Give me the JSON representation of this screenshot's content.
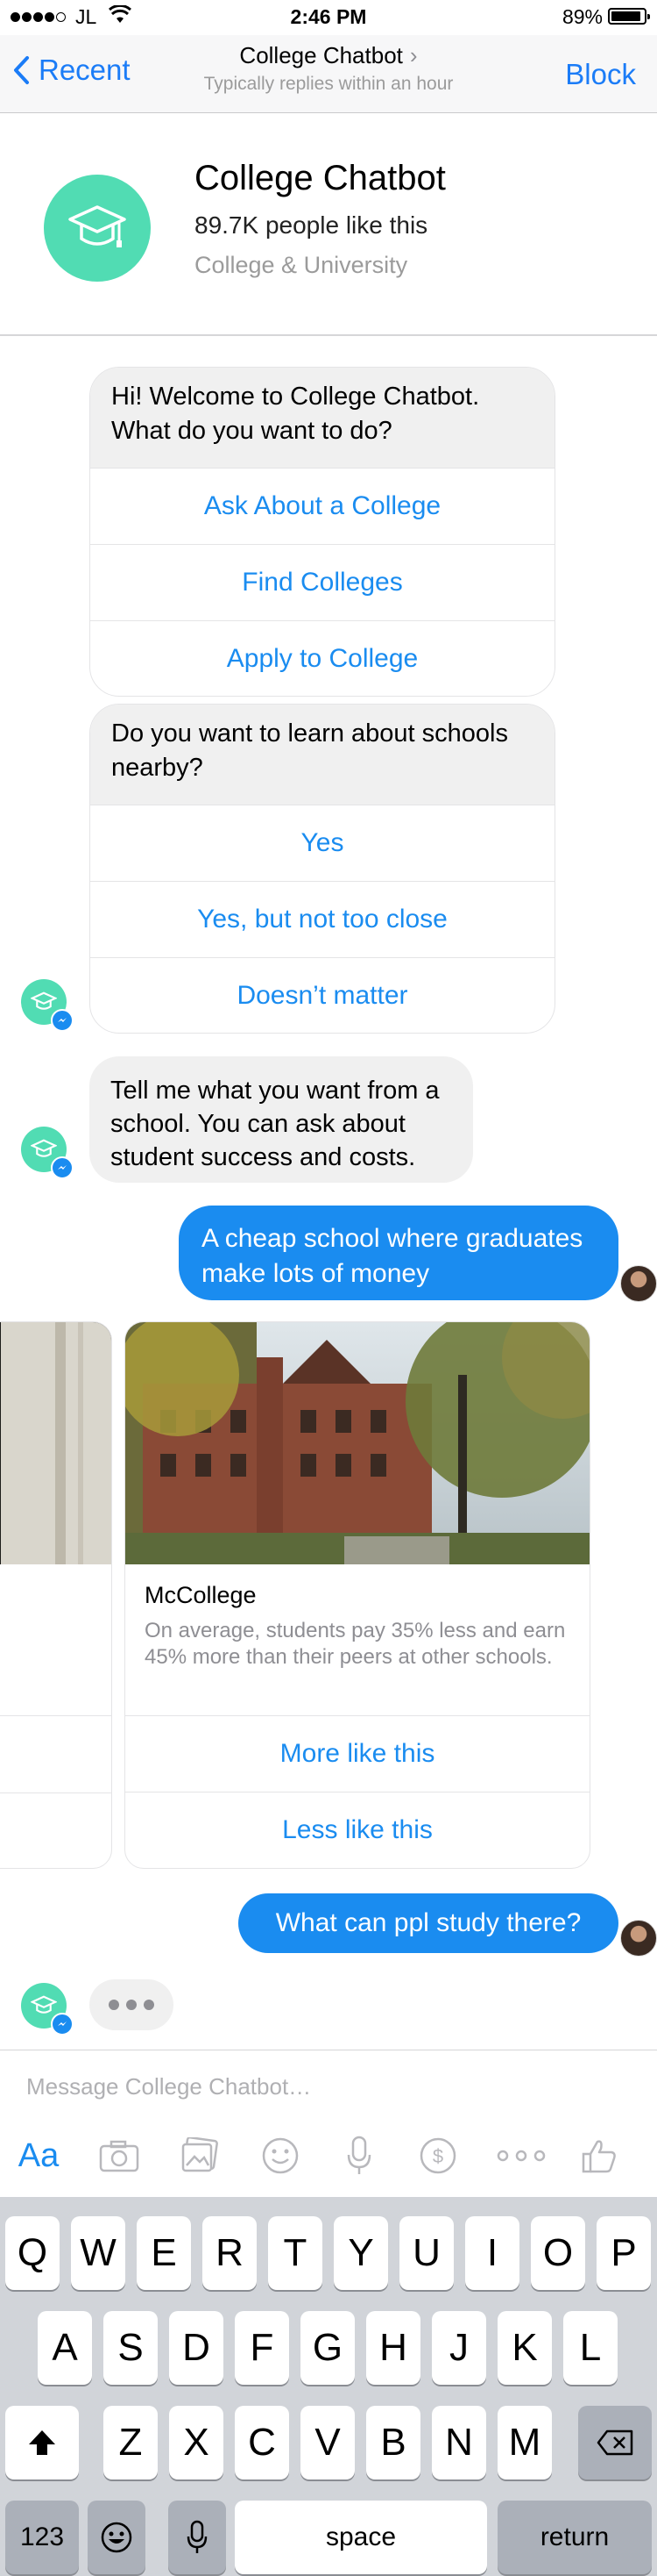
{
  "status_bar": {
    "carrier": "JL",
    "time": "2:46 PM",
    "battery": "89%",
    "battery_level": 0.89
  },
  "nav": {
    "back_label": "Recent",
    "title": "College Chatbot",
    "subtitle": "Typically replies within an hour",
    "block_label": "Block"
  },
  "page_info": {
    "name": "College Chatbot",
    "likes": "89.7K people like this",
    "category": "College & University"
  },
  "messages": {
    "welcome": {
      "text": "Hi! Welcome to College Chatbot. What do you want to do?",
      "buttons": [
        "Ask About a College",
        "Find Colleges",
        "Apply to College"
      ]
    },
    "nearby": {
      "text": "Do you want to learn about schools nearby?",
      "buttons": [
        "Yes",
        "Yes, but not too close",
        "Doesn’t matter"
      ]
    },
    "tell_me": "Tell me what you want from a school. You can ask about student success and costs.",
    "user_query_1": "A cheap school where graduates make lots of money",
    "carousel": {
      "title": "McCollege",
      "description": "On average, students pay 35% less and earn 45% more than their peers at other schools.",
      "buttons": [
        "More like this",
        "Less like this"
      ]
    },
    "user_query_2": "What can ppl study there?"
  },
  "composer": {
    "placeholder": "Message College Chatbot…",
    "aa_label": "Aa",
    "icons": [
      "camera-icon",
      "gallery-icon",
      "emoji-icon",
      "microphone-icon",
      "payment-icon",
      "more-icon",
      "like-icon"
    ]
  },
  "keyboard": {
    "row1": [
      "Q",
      "W",
      "E",
      "R",
      "T",
      "Y",
      "U",
      "I",
      "O",
      "P"
    ],
    "row2": [
      "A",
      "S",
      "D",
      "F",
      "G",
      "H",
      "J",
      "K",
      "L"
    ],
    "row3": [
      "Z",
      "X",
      "C",
      "V",
      "B",
      "N",
      "M"
    ],
    "numbers_label": "123",
    "space_label": "space",
    "return_label": "return"
  },
  "colors": {
    "accent": "#1a8cf0",
    "bot_avatar": "#51dcb3",
    "bubble_gray": "#f0f0f0",
    "keyboard_bg": "#d1d4d9"
  }
}
